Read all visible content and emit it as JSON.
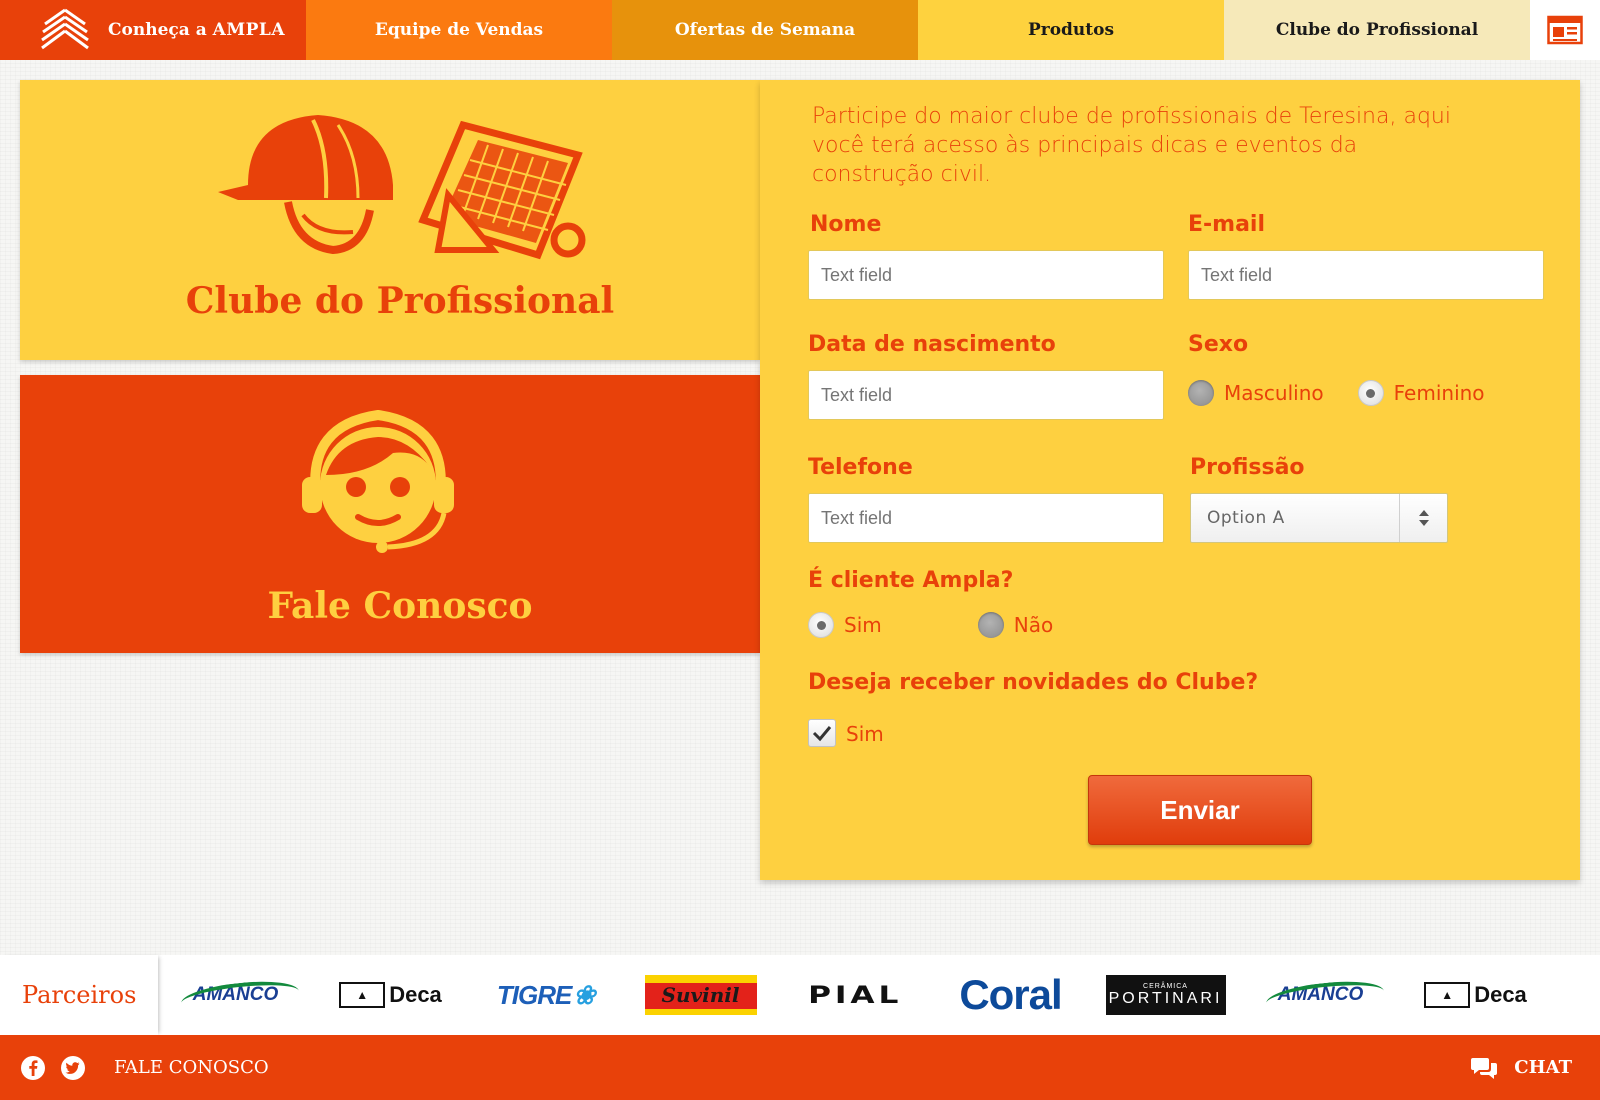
{
  "nav": {
    "brand": {
      "prefix": "Conheça a",
      "name": "AMPLA",
      "icon": "building-logo-icon"
    },
    "items": [
      {
        "label": "Equipe de Vendas",
        "color": "#fb7a10"
      },
      {
        "label": "Ofertas de Semana",
        "color": "#e7920c"
      },
      {
        "label": "Produtos",
        "color": "#fed23e"
      },
      {
        "label": "Clube do Profissional",
        "color": "#f6e9b9",
        "active": true
      }
    ],
    "news_icon": "newspaper-icon"
  },
  "cards": {
    "clube": {
      "title": "Clube do Profissional",
      "icons": [
        "hard-hat-icon",
        "blueprint-icon"
      ]
    },
    "fale": {
      "title": "Fale Conosco",
      "icon": "headset-support-icon"
    }
  },
  "form": {
    "intro": "Participe do maior clube de profissionais de Teresina, aqui você terá acesso  às principais dicas e eventos da construção civil.",
    "nome": {
      "label": "Nome",
      "placeholder": "Text field"
    },
    "email": {
      "label": "E-mail",
      "placeholder": "Text field"
    },
    "nascimento": {
      "label": "Data de nascimento",
      "placeholder": "Text field"
    },
    "sexo": {
      "label": "Sexo",
      "options": [
        "Masculino",
        "Feminino"
      ],
      "selected": "Feminino"
    },
    "telefone": {
      "label": "Telefone",
      "placeholder": "Text field"
    },
    "profissao": {
      "label": "Profissão",
      "selected": "Option  A"
    },
    "cliente": {
      "label": "É cliente Ampla?",
      "options": [
        "Sim",
        "Não"
      ],
      "selected": "Sim"
    },
    "novidades": {
      "label": "Deseja receber novidades do Clube?",
      "checkbox_label": "Sim",
      "checked": true
    },
    "submit": "Enviar"
  },
  "partners": {
    "label": "Parceiros",
    "logos": {
      "amanco": "AMANCO",
      "deca": "Deca",
      "tigre": "TIGRE",
      "suvinil": "Suvinil",
      "pial": "PIAL",
      "coral": "Coral",
      "portinari_small": "CERÂMICA",
      "portinari": "PORTINARI"
    }
  },
  "footer": {
    "social": [
      "facebook-icon",
      "twitter-icon"
    ],
    "link": "FALE CONOSCO",
    "chat": "CHAT"
  },
  "colors": {
    "primary_red": "#e8410a",
    "orange": "#fb7a10",
    "dark_orange": "#e7920c",
    "yellow": "#fed040",
    "cream": "#f6e9b9"
  }
}
